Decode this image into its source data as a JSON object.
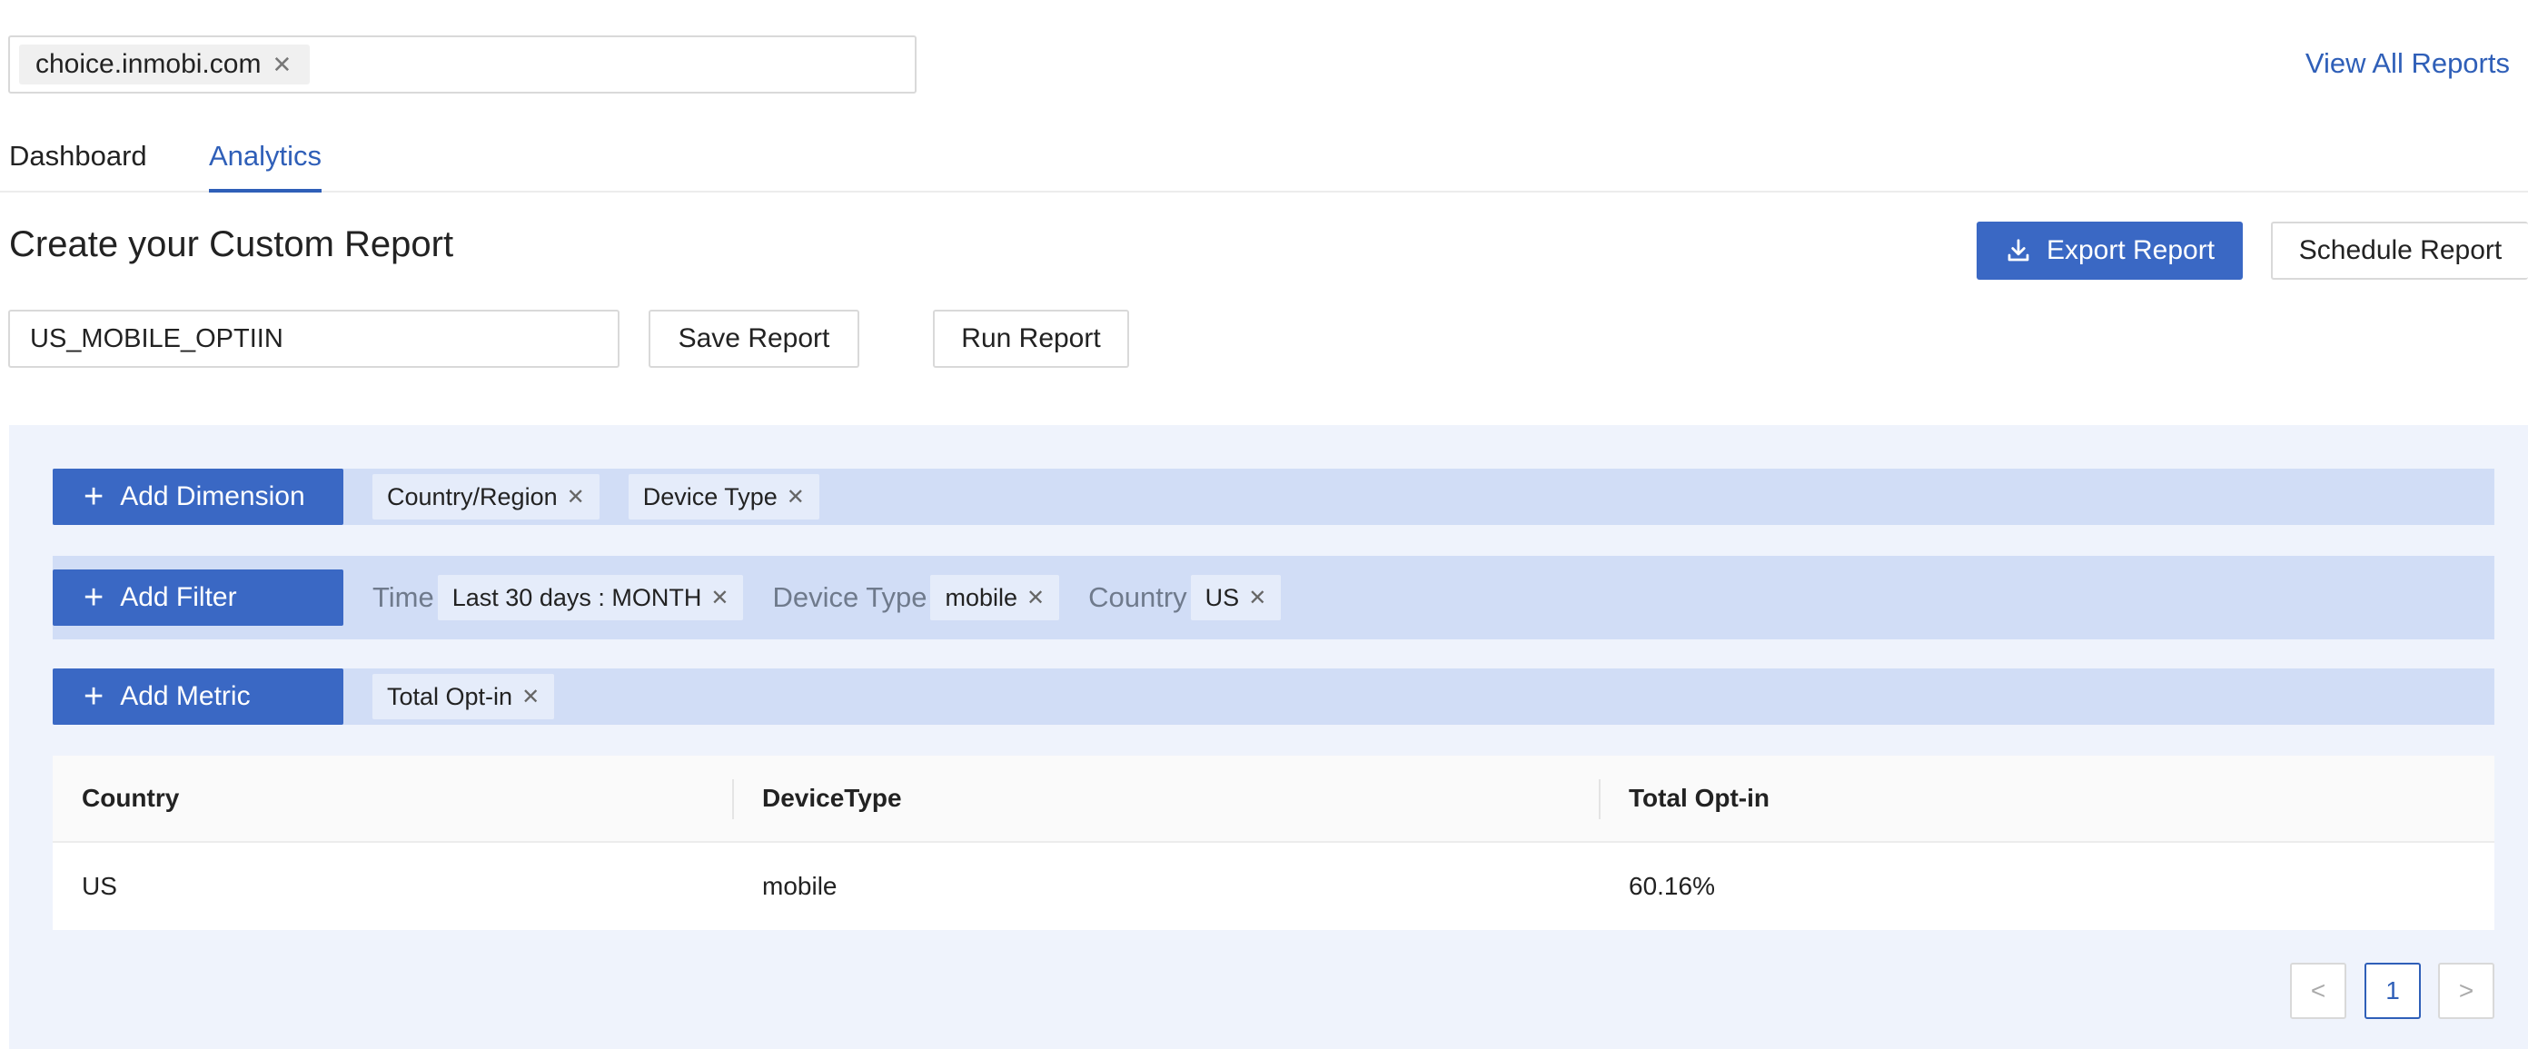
{
  "site_selector": {
    "tag": "choice.inmobi.com"
  },
  "header": {
    "view_all_link": "View All Reports"
  },
  "tabs": [
    {
      "label": "Dashboard",
      "active": false
    },
    {
      "label": "Analytics",
      "active": true
    }
  ],
  "report": {
    "title": "Create your Custom Report",
    "name_value": "US_MOBILE_OPTIIN",
    "export_label": "Export Report",
    "schedule_label": "Schedule Report",
    "save_label": "Save Report",
    "run_label": "Run Report"
  },
  "dimensions": {
    "add_label": "Add Dimension",
    "items": [
      "Country/Region",
      "Device Type"
    ]
  },
  "filters": {
    "add_label": "Add Filter",
    "items": [
      {
        "label": "Time",
        "value": "Last 30 days : MONTH"
      },
      {
        "label": "Device Type",
        "value": "mobile"
      },
      {
        "label": "Country",
        "value": "US"
      }
    ]
  },
  "metrics": {
    "add_label": "Add Metric",
    "items": [
      "Total Opt-in"
    ]
  },
  "table": {
    "columns": [
      "Country",
      "DeviceType",
      "Total Opt-in"
    ],
    "rows": [
      [
        "US",
        "mobile",
        "60.16%"
      ]
    ]
  },
  "pagination": {
    "prev": "<",
    "current": "1",
    "next": ">"
  },
  "icons": {
    "remove": "close-icon",
    "add": "plus-icon",
    "export": "download-icon"
  },
  "colors": {
    "accent": "#3a68c4",
    "link": "#2f5fb8",
    "bar": "#d1ddf6",
    "panel": "#eff3fc"
  }
}
